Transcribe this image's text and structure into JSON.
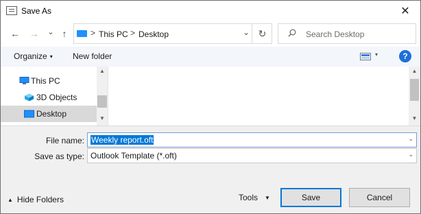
{
  "window": {
    "title": "Save As",
    "close_glyph": "✕"
  },
  "nav": {
    "back_glyph": "←",
    "forward_glyph": "→",
    "recent_glyph": "⌄",
    "up_glyph": "↑",
    "breadcrumb": [
      "This PC",
      "Desktop"
    ],
    "breadcrumb_sep": ">",
    "dropdown_glyph": "⌄",
    "refresh_glyph": "↻"
  },
  "search": {
    "placeholder": "Search Desktop"
  },
  "toolbar": {
    "organize_label": "Organize",
    "new_folder_label": "New folder",
    "help_label": "?"
  },
  "tree": {
    "items": [
      {
        "label": "This PC",
        "icon": "computer-icon",
        "selected": false
      },
      {
        "label": "3D Objects",
        "icon": "cube-icon",
        "selected": false
      },
      {
        "label": "Desktop",
        "icon": "desktop-folder-icon",
        "selected": true
      }
    ]
  },
  "form": {
    "file_name_label": "File name:",
    "file_name_value": "Weekly report.oft",
    "save_type_label": "Save as type:",
    "save_type_value": "Outlook Template (*.oft)"
  },
  "footer": {
    "hide_folders_label": "Hide Folders",
    "tools_label": "Tools",
    "save_label": "Save",
    "cancel_label": "Cancel"
  },
  "colors": {
    "accent": "#0078d7",
    "folder_blue": "#1e90ff",
    "command_bar_bg": "#f3f6fb",
    "footer_bg": "#f0f0f0"
  }
}
